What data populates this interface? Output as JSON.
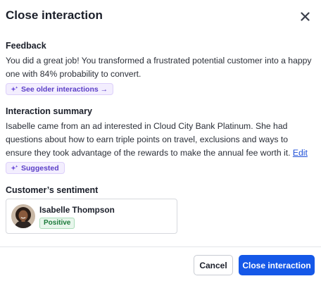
{
  "dialog": {
    "title": "Close interaction",
    "close_icon": "x-icon"
  },
  "feedback": {
    "heading": "Feedback",
    "text": "You did a great job! You transformed a frustrated potential customer into a happy one with 84% probability to convert.",
    "older_link": "See older interactions →",
    "chip_icon": "sparkle-icon"
  },
  "summary": {
    "heading": "Interaction summary",
    "text": "Isabelle came from an ad interested in Cloud City Bank Platinum. She had questions about how to earn triple points on travel, exclusions and ways to ensure they took advantage of the rewards to make the annual fee worth it.",
    "edit_link": "Edit",
    "suggested_label": "Suggested"
  },
  "sentiment": {
    "heading": "Customer’s sentiment",
    "customer_name": "Isabelle Thompson",
    "badge": "Positive",
    "colors": {
      "badge_bg": "#e8f6ec",
      "badge_text": "#1b7a3a"
    }
  },
  "footer": {
    "cancel_label": "Cancel",
    "primary_label": "Close interaction"
  },
  "colors": {
    "primary": "#1558e8",
    "accent_purple": "#5b3fc7",
    "link": "#1d4fd8"
  }
}
